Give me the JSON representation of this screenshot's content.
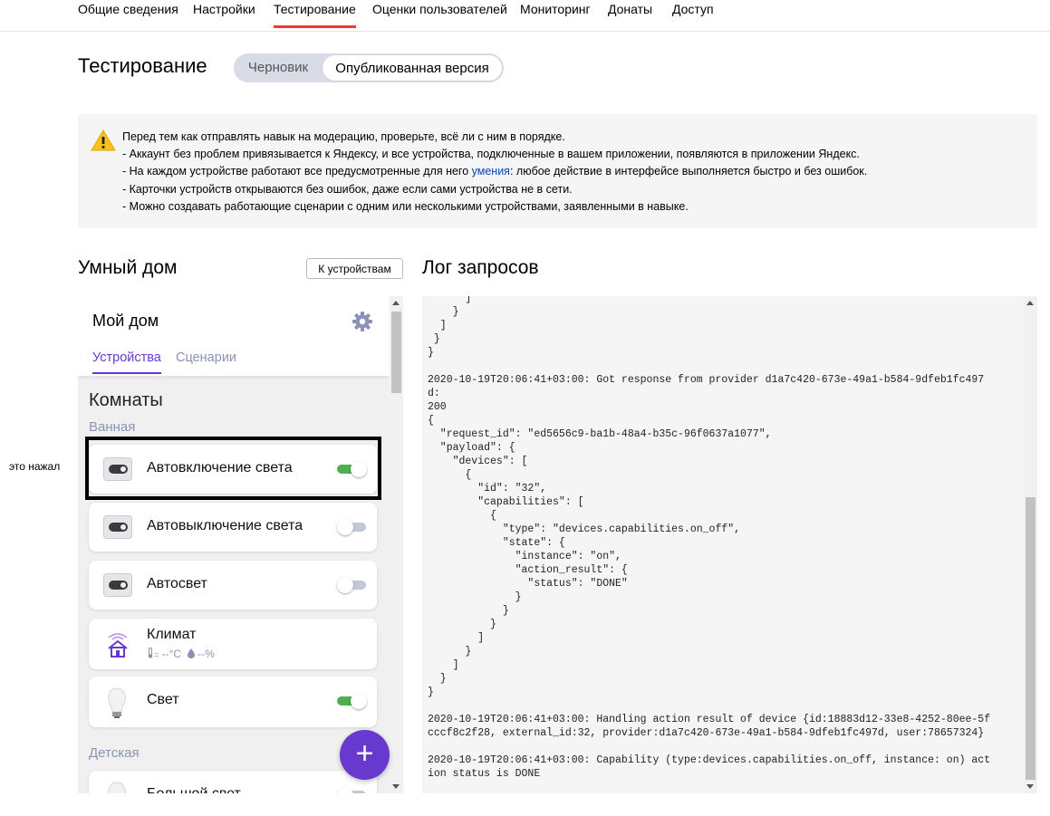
{
  "nav": {
    "items": [
      {
        "label": "Общие сведения"
      },
      {
        "label": "Настройки"
      },
      {
        "label": "Тестирование"
      },
      {
        "label": "Оценки пользователей"
      },
      {
        "label": "Мониторинг"
      },
      {
        "label": "Донаты"
      },
      {
        "label": "Доступ"
      }
    ],
    "active_index": 2
  },
  "page": {
    "title": "Тестирование",
    "segment": {
      "draft": "Черновик",
      "published": "Опубликованная версия"
    }
  },
  "notice": {
    "icon": "warning-icon",
    "line1": "Перед тем как отправлять навык на модерацию, проверьте, всё ли с ним в порядке.",
    "line2": "- Аккаунт без проблем привязывается к Яндексу, и все устройства, подключенные в вашем приложении, появляются в приложении Яндекс.",
    "line3_before": "- На каждом устройстве работают все предусмотренные для него ",
    "line3_link": "умения",
    "line3_after": ": любое действие в интерфейсе выполняется быстро и без ошибок.",
    "line4": "- Карточки устройств открываются без ошибок, даже если сами устройства не в сети.",
    "line5": "- Можно создавать работающие сценарии с одним или несколькими устройствами, заявленными в навыке."
  },
  "smart_home": {
    "title": "Умный дом",
    "to_devices_button": "К устройствам",
    "home_name": "Мой дом",
    "tabs": {
      "devices": "Устройства",
      "scenarios": "Сценарии"
    },
    "rooms_title": "Комнаты",
    "rooms": [
      {
        "name": "Ванная",
        "devices": [
          {
            "name": "Автовключение света",
            "icon": "switch-icon",
            "on": true
          },
          {
            "name": "Автовыключение света",
            "icon": "switch-icon",
            "on": false
          },
          {
            "name": "Автосвет",
            "icon": "switch-icon",
            "on": false
          },
          {
            "name": "Климат",
            "icon": "climate-house-icon",
            "temp": "--°C",
            "humidity": "--%"
          },
          {
            "name": "Свет",
            "icon": "bulb-icon",
            "on": true
          }
        ]
      },
      {
        "name": "Детская",
        "devices": [
          {
            "name": "Большой свет",
            "icon": "bulb-icon",
            "on": false
          }
        ]
      }
    ],
    "add_button": "+"
  },
  "annotation": {
    "text": "это нажал"
  },
  "log": {
    "title": "Лог запросов",
    "lines": [
      "      ]",
      "    }",
      "  ]",
      " }",
      "}",
      "",
      "2020-10-19T20:06:41+03:00: Got response from provider d1a7c420-673e-49a1-b584-9dfeb1fc497",
      "d:",
      "200",
      "{",
      "  \"request_id\": \"ed5656c9-ba1b-48a4-b35c-96f0637a1077\",",
      "  \"payload\": {",
      "    \"devices\": [",
      "      {",
      "        \"id\": \"32\",",
      "        \"capabilities\": [",
      "          {",
      "            \"type\": \"devices.capabilities.on_off\",",
      "            \"state\": {",
      "              \"instance\": \"on\",",
      "              \"action_result\": {",
      "                \"status\": \"DONE\"",
      "              }",
      "            }",
      "          }",
      "        ]",
      "      }",
      "    ]",
      "  }",
      "}",
      "",
      "2020-10-19T20:06:41+03:00: Handling action result of device {id:18883d12-33e8-4252-80ee-5f",
      "cccf8c2f28, external_id:32, provider:d1a7c420-673e-49a1-b584-9dfeb1fc497d, user:78657324}",
      "",
      "2020-10-19T20:06:41+03:00: Capability (type:devices.capabilities.on_off, instance: on) act",
      "ion status is DONE"
    ]
  },
  "colors": {
    "accent": "#6839cf",
    "nav_active": "#ff3333",
    "toggle_on": "#4caf50",
    "muted": "#8a93b5"
  }
}
